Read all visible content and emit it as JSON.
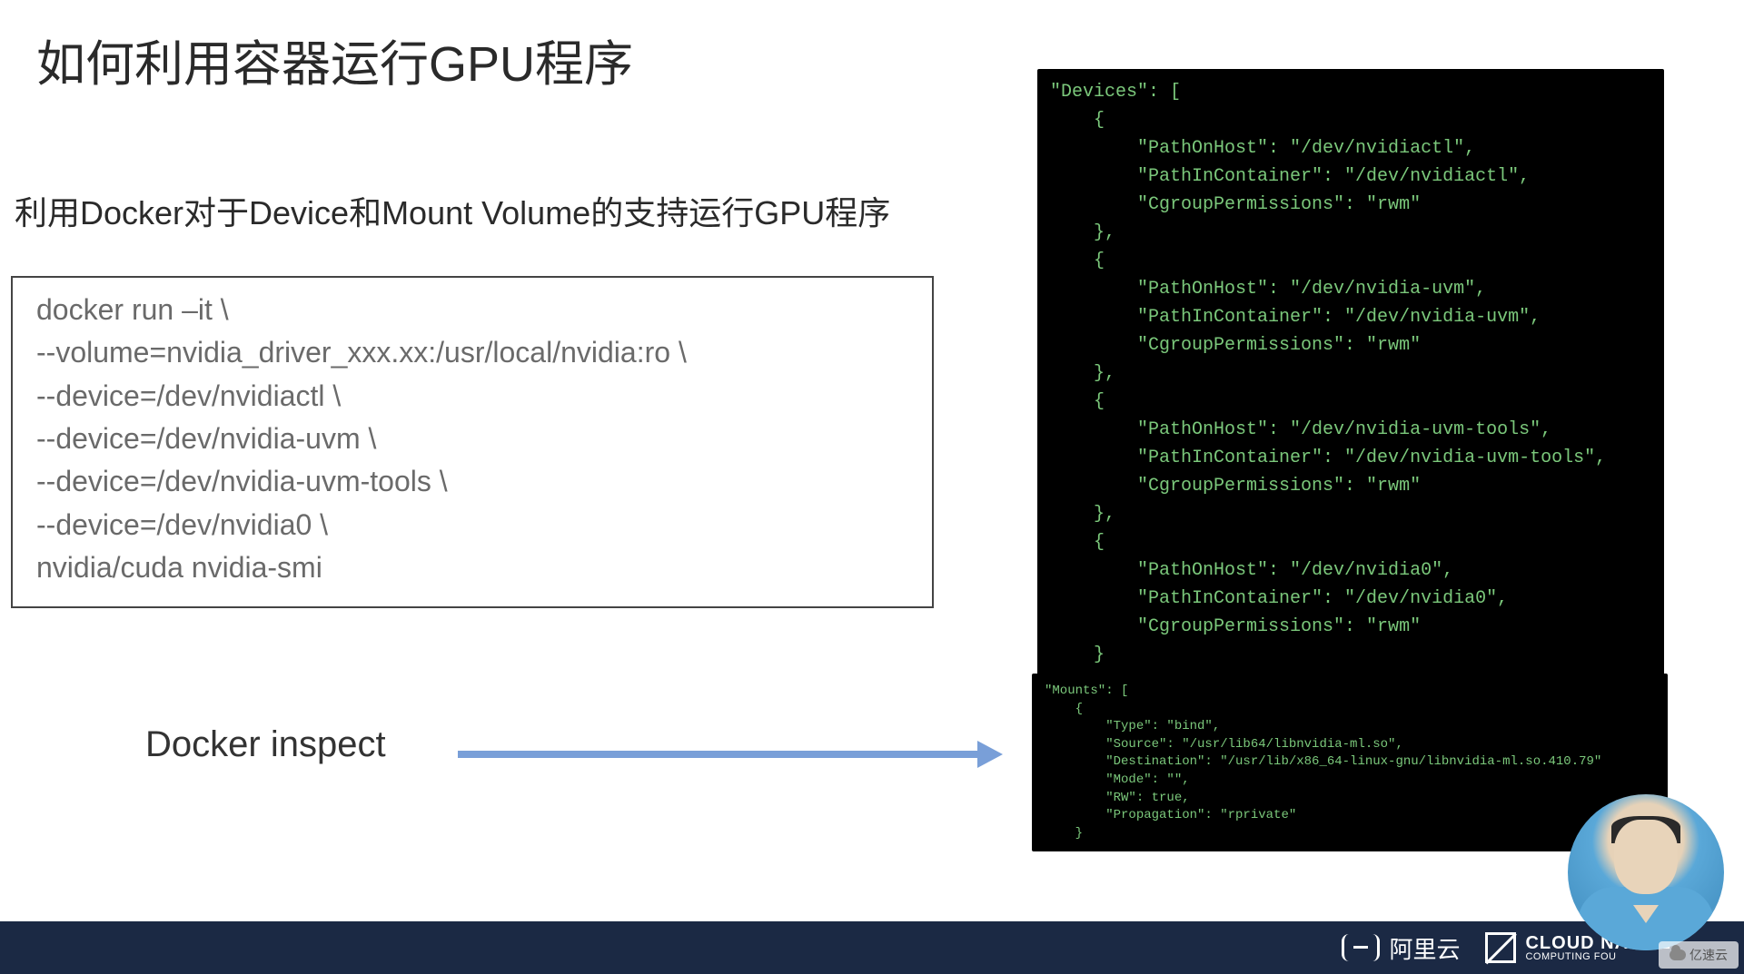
{
  "title": "如何利用容器运行GPU程序",
  "subtitle": "利用Docker对于Device和Mount Volume的支持运行GPU程序",
  "code_lines": [
    "docker run –it                      \\",
    "--volume=nvidia_driver_xxx.xx:/usr/local/nvidia:ro           \\",
    "--device=/dev/nvidiactl                 \\",
    "--device=/dev/nvidia-uvm             \\",
    "--device=/dev/nvidia-uvm-tools               \\",
    "--device=/dev/nvidia0              \\",
    "nvidia/cuda nvidia-smi"
  ],
  "inspect_label": "Docker inspect",
  "terminal1": "\"Devices\": [\n    {\n        \"PathOnHost\": \"/dev/nvidiactl\",\n        \"PathInContainer\": \"/dev/nvidiactl\",\n        \"CgroupPermissions\": \"rwm\"\n    },\n    {\n        \"PathOnHost\": \"/dev/nvidia-uvm\",\n        \"PathInContainer\": \"/dev/nvidia-uvm\",\n        \"CgroupPermissions\": \"rwm\"\n    },\n    {\n        \"PathOnHost\": \"/dev/nvidia-uvm-tools\",\n        \"PathInContainer\": \"/dev/nvidia-uvm-tools\",\n        \"CgroupPermissions\": \"rwm\"\n    },\n    {\n        \"PathOnHost\": \"/dev/nvidia0\",\n        \"PathInContainer\": \"/dev/nvidia0\",\n        \"CgroupPermissions\": \"rwm\"\n    }\n],",
  "terminal2": "\"Mounts\": [\n    {\n        \"Type\": \"bind\",\n        \"Source\": \"/usr/lib64/libnvidia-ml.so\",\n        \"Destination\": \"/usr/lib/x86_64-linux-gnu/libnvidia-ml.so.410.79\"\n        \"Mode\": \"\",\n        \"RW\": true,\n        \"Propagation\": \"rprivate\"\n    }",
  "footer": {
    "aliyun": "阿里云",
    "cncf_big": "CLOUD NATIVE",
    "cncf_small": "COMPUTING FOU"
  },
  "watermark": "亿速云"
}
